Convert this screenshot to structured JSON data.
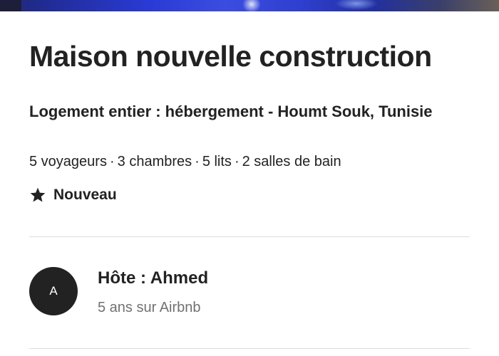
{
  "listing": {
    "title": "Maison nouvelle construction",
    "subtitle": "Logement entier : hébergement - Houmt Souk, Tunisie",
    "details": [
      "5 voyageurs",
      "3 chambres",
      "5 lits",
      "2 salles de bain"
    ],
    "separator": "·",
    "badge": {
      "icon": "star-icon",
      "label": "Nouveau"
    }
  },
  "host": {
    "avatar_initial": "A",
    "name": "Hôte : Ahmed",
    "since": "5 ans sur Airbnb"
  },
  "colors": {
    "text_primary": "#222222",
    "text_secondary": "#717171",
    "divider": "#dddddd",
    "avatar_bg": "#222222"
  }
}
